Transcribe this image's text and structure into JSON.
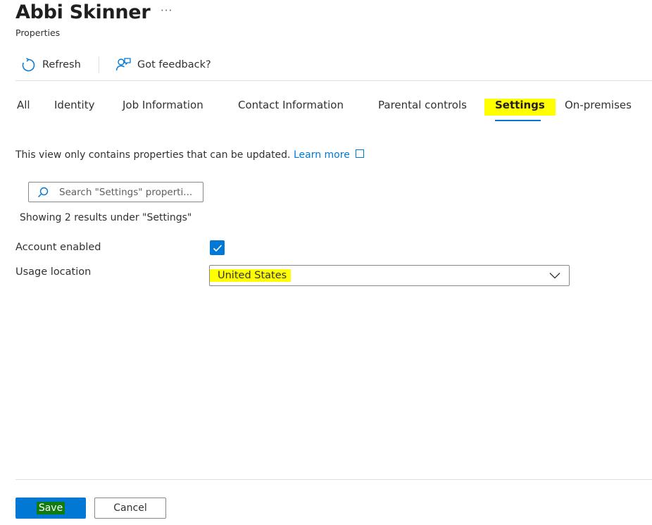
{
  "header": {
    "title": "Abbi Skinner",
    "more": "···",
    "subtitle": "Properties"
  },
  "toolbar": {
    "refresh_label": "Refresh",
    "feedback_label": "Got feedback?"
  },
  "tabs": [
    {
      "label": "All"
    },
    {
      "label": "Identity"
    },
    {
      "label": "Job Information"
    },
    {
      "label": "Contact Information"
    },
    {
      "label": "Parental controls"
    },
    {
      "label": "Settings",
      "active": true
    },
    {
      "label": "On-premises"
    }
  ],
  "info": {
    "text": "This view only contains properties that can be updated.",
    "link": "Learn more"
  },
  "search": {
    "placeholder": "Search \"Settings\" properti...",
    "value": ""
  },
  "results_text": "Showing 2 results under \"Settings\"",
  "fields": {
    "account_enabled": {
      "label": "Account enabled",
      "checked": true
    },
    "usage_location": {
      "label": "Usage location",
      "value": "United States"
    }
  },
  "footer": {
    "save_label": "Save",
    "cancel_label": "Cancel"
  },
  "colors": {
    "accent": "#0078d4",
    "highlight": "#ffff00",
    "save_highlight": "#107c10"
  }
}
